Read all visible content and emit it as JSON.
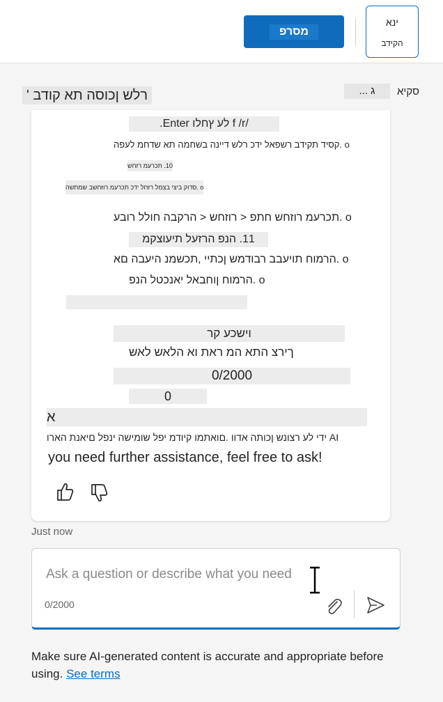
{
  "header": {
    "publish_label": "מסרפ",
    "me_label": "ינא",
    "me_sub": "הקידב"
  },
  "panel": {
    "title": "רלש ןכוסה תא קודב '",
    "side_label": "סקיא",
    "side_chip": "... ג"
  },
  "message": {
    "lines": [
      "/f /r לע ץחלו Enter.",
      "o .קסיד תקידב רשפאל ידכ רלש דיינה בשחמה תא שדחמ לעפה",
      "10. תכרעמ רזחש",
      "o .סדוק ביצי בצמל רזחל ידכ תכרעמ רוזחשב שמתשה",
      "o .תכרעמ רוזחש חתפ < רוזחש < הרקבה חולל רובע",
      "11. הנפ הרזעל תיעוצקמ",
      "o .הרמוח תויעבב רבודמש ןכתיי ,תכשמנ היעבה םא",
      "o .הרמוח ןוחבאל יאנכטל הנפ",
      "וישכע קר",
      "ךירצ התא המ ראת וא הלאש לאש",
      "0/2000",
      "0",
      "א",
      "AI ידי לע רצונש ןכותה אדוו .םואתמו קיודמ יפל שומישה ינפל םיאנת הארו",
      "you need further assistance, feel free to ask!"
    ]
  },
  "timestamp": "Just now",
  "composer": {
    "placeholder": "Ask a question or describe what you need",
    "counter": "0/2000"
  },
  "footer": {
    "text": "Make sure AI-generated content is accurate and appropriate before using. ",
    "link": "See terms"
  }
}
